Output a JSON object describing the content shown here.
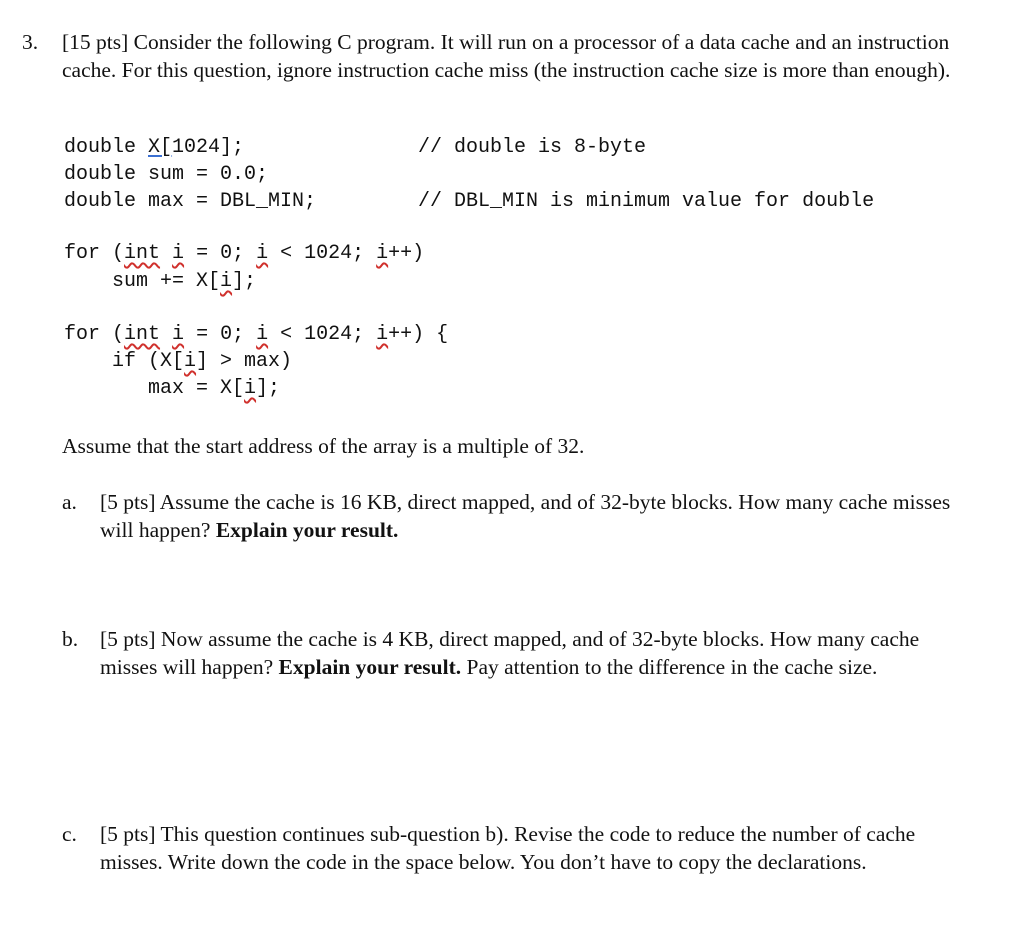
{
  "question": {
    "number": "3.",
    "points": "[15 pts]",
    "intro": "Consider the following C program. It will run on a processor of a data cache and an instruction cache. For this question, ignore instruction cache miss (the instruction cache size is more than enough)."
  },
  "code": {
    "decl": [
      {
        "type": "double ",
        "var": "X[",
        "rest": "1024];",
        "comment": "// double is 8-byte"
      },
      {
        "text": "double sum = 0.0;"
      },
      {
        "text": "double max = DBL_MIN;",
        "comment": "// DBL_MIN is minimum value for double"
      }
    ],
    "loop1": {
      "for_kw": "for (",
      "int_kw": "int",
      "i": "i",
      "init": " = 0; ",
      "cond": " < 1024; ",
      "inc": "++)",
      "body_pre": "    sum += X[",
      "body_post": "];"
    },
    "loop2": {
      "for_kw": "for (",
      "int_kw": "int",
      "i": "i",
      "init": " = 0; ",
      "cond": " < 1024; ",
      "inc": "++) {",
      "if_pre": "    if (X[",
      "if_post": "] > max)",
      "body_pre": "       max = X[",
      "body_post": "];"
    }
  },
  "assumption": "Assume that the start address of the array is a multiple of 32.",
  "subquestions": [
    {
      "label": "a.",
      "points": "[5 pts]",
      "text": "Assume the cache is 16 KB, direct mapped, and of 32-byte blocks. How many cache misses will happen?",
      "bold": "Explain your result.",
      "tail": ""
    },
    {
      "label": "b.",
      "points": "[5 pts]",
      "text": "Now assume the cache is 4 KB, direct mapped, and of 32-byte blocks. How many cache misses will happen?",
      "bold": "Explain your result.",
      "tail": "Pay attention to the difference in the cache size."
    },
    {
      "label": "c.",
      "points": "[5 pts]",
      "text": "This question continues sub-question b). Revise the code to reduce the number of cache misses. Write down the code in the space below. You don’t have to copy the declarations.",
      "bold": "",
      "tail": ""
    }
  ]
}
